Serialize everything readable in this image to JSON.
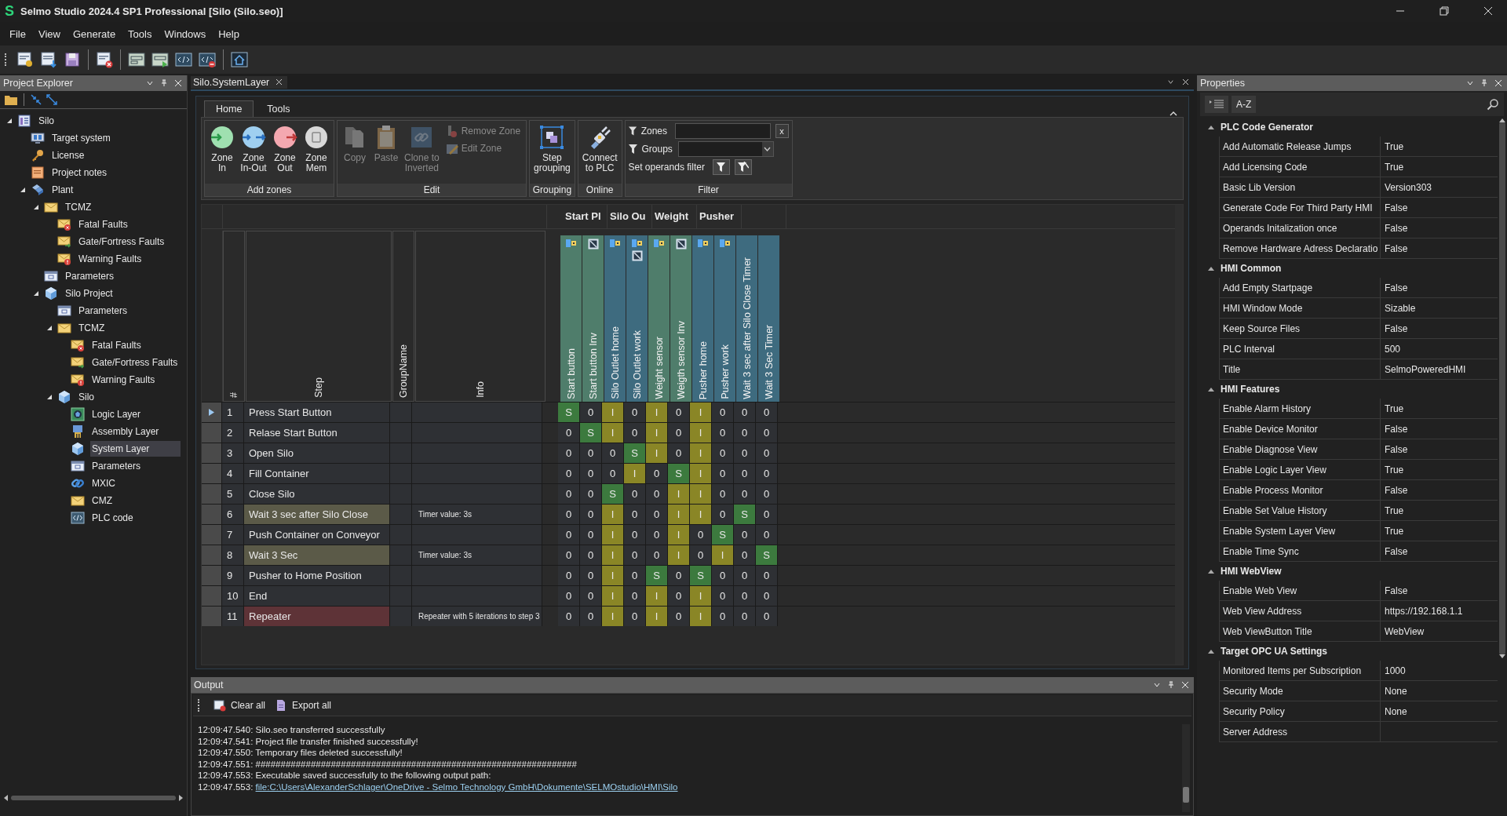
{
  "window": {
    "logo": "S",
    "title": "Selmo Studio 2024.4 SP1 Professional  [Silo (Silo.seo)]"
  },
  "menu": [
    "File",
    "View",
    "Generate",
    "Tools",
    "Windows",
    "Help"
  ],
  "toolbar": [
    {
      "kind": "new-project"
    },
    {
      "kind": "open"
    },
    {
      "kind": "save"
    },
    {
      "kind": "sep"
    },
    {
      "kind": "close-project"
    },
    {
      "kind": "sep"
    },
    {
      "kind": "layout"
    },
    {
      "kind": "run-layout"
    },
    {
      "kind": "code"
    },
    {
      "kind": "code-remove"
    },
    {
      "kind": "sep"
    },
    {
      "kind": "home"
    }
  ],
  "explorer": {
    "title": "Project Explorer",
    "tree": [
      {
        "label": "Silo",
        "kind": "project",
        "expanded": true,
        "selected": false,
        "children": [
          {
            "label": "Target system",
            "kind": "monitor",
            "selected": false
          },
          {
            "label": "License",
            "kind": "key",
            "selected": false
          },
          {
            "label": "Project notes",
            "kind": "notes",
            "selected": false
          },
          {
            "label": "Plant",
            "kind": "plant",
            "expanded": true,
            "selected": false,
            "children": [
              {
                "label": "TCMZ",
                "kind": "folder",
                "expanded": true,
                "selected": false,
                "children": [
                  {
                    "label": "Fatal Faults",
                    "kind": "fatal",
                    "selected": false
                  },
                  {
                    "label": "Gate/Fortress Faults",
                    "kind": "gate",
                    "selected": false
                  },
                  {
                    "label": "Warning Faults",
                    "kind": "warning",
                    "selected": false
                  }
                ]
              },
              {
                "label": "Parameters",
                "kind": "params",
                "selected": false
              },
              {
                "label": "Silo Project",
                "kind": "cube",
                "expanded": true,
                "selected": false,
                "children": [
                  {
                    "label": "Parameters",
                    "kind": "params",
                    "selected": false
                  },
                  {
                    "label": "TCMZ",
                    "kind": "folder",
                    "expanded": true,
                    "selected": false,
                    "children": [
                      {
                        "label": "Fatal Faults",
                        "kind": "fatal",
                        "selected": false
                      },
                      {
                        "label": "Gate/Fortress Faults",
                        "kind": "gate",
                        "selected": false
                      },
                      {
                        "label": "Warning Faults",
                        "kind": "warning",
                        "selected": false
                      }
                    ]
                  },
                  {
                    "label": "Silo",
                    "kind": "cube",
                    "expanded": true,
                    "selected": false,
                    "children": [
                      {
                        "label": "Logic Layer",
                        "kind": "logic",
                        "selected": false
                      },
                      {
                        "label": "Assembly Layer",
                        "kind": "assembly",
                        "selected": false
                      },
                      {
                        "label": "System Layer",
                        "kind": "cube",
                        "selected": true
                      },
                      {
                        "label": "Parameters",
                        "kind": "params",
                        "selected": false
                      },
                      {
                        "label": "MXIC",
                        "kind": "mxic",
                        "selected": false
                      },
                      {
                        "label": "CMZ",
                        "kind": "folder",
                        "selected": false
                      },
                      {
                        "label": "PLC code",
                        "kind": "code",
                        "selected": false
                      }
                    ]
                  }
                ]
              }
            ]
          }
        ]
      }
    ]
  },
  "document": {
    "tab": "Silo.SystemLayer",
    "ribbon": {
      "tabs": [
        {
          "label": "Home",
          "selected": true
        },
        {
          "label": "Tools",
          "selected": false
        }
      ],
      "groups": [
        {
          "label": "Add zones",
          "buttons": [
            {
              "label": "Zone\nIn",
              "kind": "zone-in",
              "disabled": false
            },
            {
              "label": "Zone\nIn-Out",
              "kind": "zone-inout",
              "disabled": false
            },
            {
              "label": "Zone\nOut",
              "kind": "zone-out",
              "disabled": false
            },
            {
              "label": "Zone\nMem",
              "kind": "zone-mem",
              "disabled": false
            }
          ]
        },
        {
          "label": "Edit",
          "buttons": [
            {
              "label": "Copy",
              "kind": "copy",
              "disabled": true
            },
            {
              "label": "Paste",
              "kind": "paste",
              "disabled": true
            },
            {
              "label": "Clone to\nInverted",
              "kind": "clone",
              "disabled": true
            }
          ],
          "small_buttons": [
            {
              "label": "Remove Zone",
              "kind": "remove",
              "disabled": true
            },
            {
              "label": "Edit Zone",
              "kind": "edit",
              "disabled": true
            }
          ]
        },
        {
          "label": "Grouping",
          "buttons": [
            {
              "label": "Step\ngrouping",
              "kind": "group",
              "disabled": false
            }
          ]
        },
        {
          "label": "Online",
          "buttons": [
            {
              "label": "Connect\nto PLC",
              "kind": "connect",
              "disabled": false
            }
          ]
        }
      ],
      "filter": {
        "label": "Filter",
        "zones": "Zones",
        "groups": "Groups",
        "clear": "x",
        "operands": "Set operands filter"
      }
    },
    "grid": {
      "columns": [
        "#",
        "Step",
        "GroupName",
        "Info"
      ],
      "operand_groups": [
        {
          "label": "Start Pl",
          "operands": [
            {
              "name": "Start button",
              "color": "#4f7d6b",
              "kind": "sensor"
            },
            {
              "name": "Start button Inv",
              "color": "#4f7d6b",
              "kind": "inverted"
            }
          ]
        },
        {
          "label": "Silo Ou",
          "operands": [
            {
              "name": "Silo Outlet home",
              "color": "#3e6b7f",
              "kind": "sensor"
            },
            {
              "name": "Silo Outlet work",
              "color": "#3e6b7f",
              "kind": "both"
            }
          ]
        },
        {
          "label": "Weight",
          "operands": [
            {
              "name": "Weight sensor",
              "color": "#4f7d6b",
              "kind": "sensor"
            },
            {
              "name": "Weigth sensor Inv",
              "color": "#4f7d6b",
              "kind": "inverted"
            }
          ]
        },
        {
          "label": "Pusher",
          "operands": [
            {
              "name": "Pusher home",
              "color": "#3e6b7f",
              "kind": "sensor"
            },
            {
              "name": "Pusher work",
              "color": "#3e6b7f",
              "kind": "sensor"
            }
          ]
        },
        {
          "operands": [
            {
              "name": "Wait 3 sec after Silo Close Timer",
              "color": "#3e6b7f",
              "kind": "timer"
            },
            {
              "name": "Wait 3 Sec Timer",
              "color": "#3e6b7f",
              "kind": "timer"
            }
          ]
        }
      ],
      "rows": [
        {
          "number": "1",
          "step": "Press Start Button",
          "kind": "step",
          "selected": true,
          "cells": [
            {
              "text": "S",
              "kind": "set"
            },
            {
              "text": "0",
              "kind": "zero"
            },
            {
              "text": "I",
              "kind": "ignore"
            },
            {
              "text": "0",
              "kind": "zero"
            },
            {
              "text": "I",
              "kind": "ignore"
            },
            {
              "text": "0",
              "kind": "zero"
            },
            {
              "text": "I",
              "kind": "ignore"
            },
            {
              "text": "0",
              "kind": "zero"
            },
            {
              "text": "0",
              "kind": "zero"
            },
            {
              "text": "0",
              "kind": "zero"
            }
          ]
        },
        {
          "number": "2",
          "step": "Relase Start Button",
          "kind": "step",
          "selected": false,
          "cells": [
            {
              "text": "0",
              "kind": "zero"
            },
            {
              "text": "S",
              "kind": "set"
            },
            {
              "text": "I",
              "kind": "ignore"
            },
            {
              "text": "0",
              "kind": "zero"
            },
            {
              "text": "I",
              "kind": "ignore"
            },
            {
              "text": "0",
              "kind": "zero"
            },
            {
              "text": "I",
              "kind": "ignore"
            },
            {
              "text": "0",
              "kind": "zero"
            },
            {
              "text": "0",
              "kind": "zero"
            },
            {
              "text": "0",
              "kind": "zero"
            }
          ]
        },
        {
          "number": "3",
          "step": "Open Silo",
          "kind": "step",
          "selected": false,
          "cells": [
            {
              "text": "0",
              "kind": "zero"
            },
            {
              "text": "0",
              "kind": "zero"
            },
            {
              "text": "0",
              "kind": "zero"
            },
            {
              "text": "S",
              "kind": "set"
            },
            {
              "text": "I",
              "kind": "ignore"
            },
            {
              "text": "0",
              "kind": "zero"
            },
            {
              "text": "I",
              "kind": "ignore"
            },
            {
              "text": "0",
              "kind": "zero"
            },
            {
              "text": "0",
              "kind": "zero"
            },
            {
              "text": "0",
              "kind": "zero"
            }
          ]
        },
        {
          "number": "4",
          "step": "Fill Container",
          "kind": "step",
          "selected": false,
          "cells": [
            {
              "text": "0",
              "kind": "zero"
            },
            {
              "text": "0",
              "kind": "zero"
            },
            {
              "text": "0",
              "kind": "zero"
            },
            {
              "text": "I",
              "kind": "ignore"
            },
            {
              "text": "0",
              "kind": "zero"
            },
            {
              "text": "S",
              "kind": "set"
            },
            {
              "text": "I",
              "kind": "ignore"
            },
            {
              "text": "0",
              "kind": "zero"
            },
            {
              "text": "0",
              "kind": "zero"
            },
            {
              "text": "0",
              "kind": "zero"
            }
          ]
        },
        {
          "number": "5",
          "step": "Close Silo",
          "kind": "step",
          "selected": false,
          "cells": [
            {
              "text": "0",
              "kind": "zero"
            },
            {
              "text": "0",
              "kind": "zero"
            },
            {
              "text": "S",
              "kind": "set"
            },
            {
              "text": "0",
              "kind": "zero"
            },
            {
              "text": "0",
              "kind": "zero"
            },
            {
              "text": "I",
              "kind": "ignore"
            },
            {
              "text": "I",
              "kind": "ignore"
            },
            {
              "text": "0",
              "kind": "zero"
            },
            {
              "text": "0",
              "kind": "zero"
            },
            {
              "text": "0",
              "kind": "zero"
            }
          ]
        },
        {
          "number": "6",
          "step": "Wait 3 sec after Silo Close",
          "info": "Timer value: 3s",
          "kind": "timer",
          "selected": false,
          "cells": [
            {
              "text": "0",
              "kind": "zero"
            },
            {
              "text": "0",
              "kind": "zero"
            },
            {
              "text": "I",
              "kind": "ignore"
            },
            {
              "text": "0",
              "kind": "zero"
            },
            {
              "text": "0",
              "kind": "zero"
            },
            {
              "text": "I",
              "kind": "ignore"
            },
            {
              "text": "I",
              "kind": "ignore"
            },
            {
              "text": "0",
              "kind": "zero"
            },
            {
              "text": "S",
              "kind": "set"
            },
            {
              "text": "0",
              "kind": "zero"
            }
          ]
        },
        {
          "number": "7",
          "step": "Push Container on Conveyor",
          "kind": "step",
          "selected": false,
          "cells": [
            {
              "text": "0",
              "kind": "zero"
            },
            {
              "text": "0",
              "kind": "zero"
            },
            {
              "text": "I",
              "kind": "ignore"
            },
            {
              "text": "0",
              "kind": "zero"
            },
            {
              "text": "0",
              "kind": "zero"
            },
            {
              "text": "I",
              "kind": "ignore"
            },
            {
              "text": "0",
              "kind": "zero"
            },
            {
              "text": "S",
              "kind": "set"
            },
            {
              "text": "0",
              "kind": "zero"
            },
            {
              "text": "0",
              "kind": "zero"
            }
          ]
        },
        {
          "number": "8",
          "step": "Wait 3 Sec",
          "info": "Timer value: 3s",
          "kind": "timer",
          "selected": false,
          "cells": [
            {
              "text": "0",
              "kind": "zero"
            },
            {
              "text": "0",
              "kind": "zero"
            },
            {
              "text": "I",
              "kind": "ignore"
            },
            {
              "text": "0",
              "kind": "zero"
            },
            {
              "text": "0",
              "kind": "zero"
            },
            {
              "text": "I",
              "kind": "ignore"
            },
            {
              "text": "0",
              "kind": "zero"
            },
            {
              "text": "I",
              "kind": "ignore"
            },
            {
              "text": "0",
              "kind": "zero"
            },
            {
              "text": "S",
              "kind": "set"
            }
          ]
        },
        {
          "number": "9",
          "step": "Pusher to Home Position",
          "kind": "step",
          "selected": false,
          "cells": [
            {
              "text": "0",
              "kind": "zero"
            },
            {
              "text": "0",
              "kind": "zero"
            },
            {
              "text": "I",
              "kind": "ignore"
            },
            {
              "text": "0",
              "kind": "zero"
            },
            {
              "text": "S",
              "kind": "set"
            },
            {
              "text": "0",
              "kind": "zero"
            },
            {
              "text": "S",
              "kind": "set"
            },
            {
              "text": "0",
              "kind": "zero"
            },
            {
              "text": "0",
              "kind": "zero"
            },
            {
              "text": "0",
              "kind": "zero"
            }
          ]
        },
        {
          "number": "10",
          "step": "End",
          "kind": "step",
          "selected": false,
          "cells": [
            {
              "text": "0",
              "kind": "zero"
            },
            {
              "text": "0",
              "kind": "zero"
            },
            {
              "text": "I",
              "kind": "ignore"
            },
            {
              "text": "0",
              "kind": "zero"
            },
            {
              "text": "I",
              "kind": "ignore"
            },
            {
              "text": "0",
              "kind": "zero"
            },
            {
              "text": "I",
              "kind": "ignore"
            },
            {
              "text": "0",
              "kind": "zero"
            },
            {
              "text": "0",
              "kind": "zero"
            },
            {
              "text": "0",
              "kind": "zero"
            }
          ]
        },
        {
          "number": "11",
          "step": "Repeater",
          "info": "Repeater with 5 iterations to step 3",
          "kind": "repeater",
          "selected": false,
          "cells": [
            {
              "text": "0",
              "kind": "zero"
            },
            {
              "text": "0",
              "kind": "zero"
            },
            {
              "text": "I",
              "kind": "ignore"
            },
            {
              "text": "0",
              "kind": "zero"
            },
            {
              "text": "I",
              "kind": "ignore"
            },
            {
              "text": "0",
              "kind": "zero"
            },
            {
              "text": "I",
              "kind": "ignore"
            },
            {
              "text": "0",
              "kind": "zero"
            },
            {
              "text": "0",
              "kind": "zero"
            },
            {
              "text": "0",
              "kind": "zero"
            }
          ]
        }
      ]
    }
  },
  "output": {
    "title": "Output",
    "actions": [
      "Clear all",
      "Export all"
    ],
    "lines": [
      {
        "text": "12:09:47.540: Silo.seo transferred successfully"
      },
      {
        "text": "12:09:47.541: Project file transfer finished successfully!"
      },
      {
        "text": "12:09:47.550: Temporary files deleted successfully!"
      },
      {
        "text": "12:09:47.551: ################################################################"
      },
      {
        "text": "12:09:47.553: Executable saved successfully to the following output path:"
      },
      {
        "text": "12:09:47.553: ",
        "link": "file:C:\\Users\\AlexanderSchlager\\OneDrive - Selmo Technology GmbH\\Dokumente\\SELMOstudio\\HMI\\Silo"
      }
    ]
  },
  "properties": {
    "title": "Properties",
    "sort": "A-Z",
    "categories": [
      {
        "name": "PLC Code Generator",
        "expanded": true,
        "items": [
          {
            "name": "Add Automatic Release Jumps",
            "value": "True"
          },
          {
            "name": "Add Licensing Code",
            "value": "True"
          },
          {
            "name": "Basic Lib Version",
            "value": "Version303"
          },
          {
            "name": "Generate Code For Third Party HMI",
            "value": "False"
          },
          {
            "name": "Operands Initalization once",
            "value": "False"
          },
          {
            "name": "Remove Hardware Adress Declaratio",
            "value": "False"
          }
        ]
      },
      {
        "name": "HMI Common",
        "expanded": true,
        "items": [
          {
            "name": "Add Empty Startpage",
            "value": "False"
          },
          {
            "name": "HMI Window Mode",
            "value": "Sizable"
          },
          {
            "name": "Keep Source Files",
            "value": "False"
          },
          {
            "name": "PLC Interval",
            "value": "500"
          },
          {
            "name": "Title",
            "value": "SelmoPoweredHMI"
          }
        ]
      },
      {
        "name": "HMI Features",
        "expanded": true,
        "items": [
          {
            "name": "Enable Alarm History",
            "value": "True"
          },
          {
            "name": "Enable Device Monitor",
            "value": "False"
          },
          {
            "name": "Enable Diagnose View",
            "value": "False"
          },
          {
            "name": "Enable Logic Layer View",
            "value": "True"
          },
          {
            "name": "Enable Process Monitor",
            "value": "False"
          },
          {
            "name": "Enable Set Value History",
            "value": "True"
          },
          {
            "name": "Enable System Layer View",
            "value": "True"
          },
          {
            "name": "Enable Time Sync",
            "value": "False"
          }
        ]
      },
      {
        "name": "HMI WebView",
        "expanded": true,
        "items": [
          {
            "name": "Enable Web View",
            "value": "False"
          },
          {
            "name": "Web View Address",
            "value": "https://192.168.1.1"
          },
          {
            "name": "Web ViewButton Title",
            "value": "WebView"
          }
        ]
      },
      {
        "name": "Target OPC UA Settings",
        "expanded": true,
        "items": [
          {
            "name": "Monitored Items per Subscription",
            "value": "1000"
          },
          {
            "name": "Security Mode",
            "value": "None"
          },
          {
            "name": "Security Policy",
            "value": "None"
          },
          {
            "name": "Server Address",
            "value": ""
          }
        ]
      }
    ]
  }
}
